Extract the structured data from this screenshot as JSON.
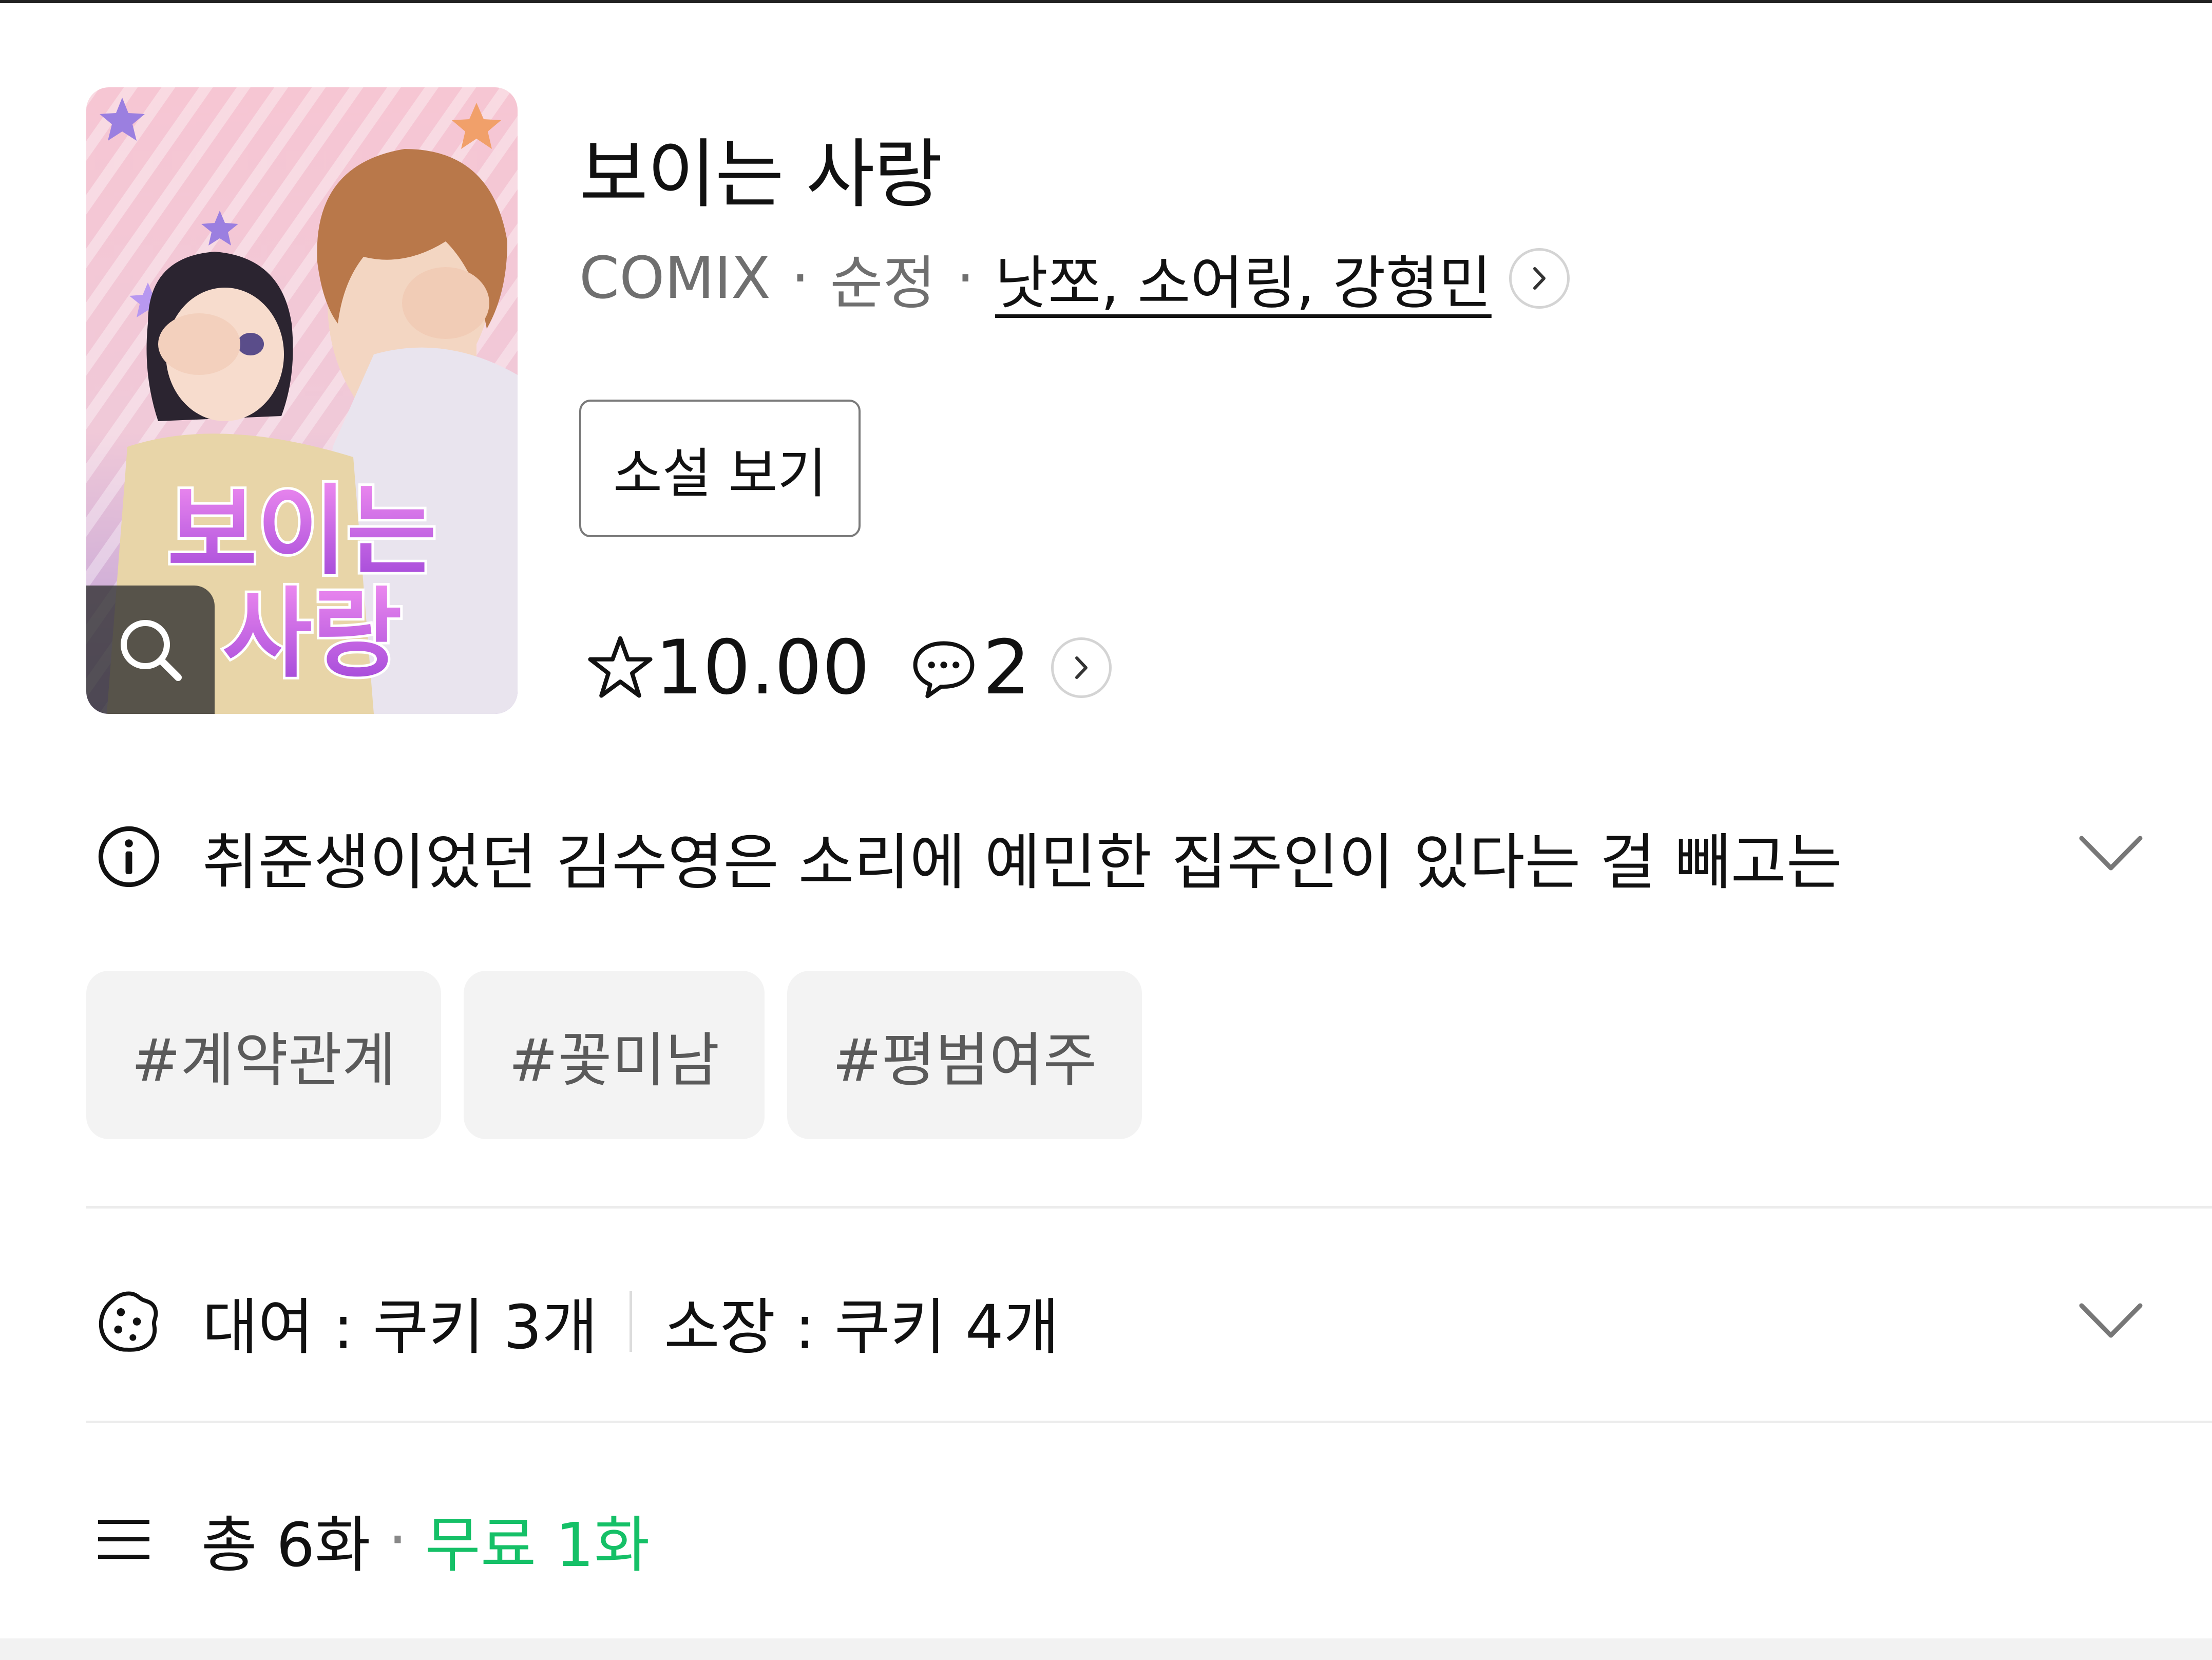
{
  "cover": {
    "alt": "보이는 사랑 표지",
    "logo_line1": "보이는",
    "logo_line2": "사랑",
    "icon": "search-icon"
  },
  "title": "보이는 사랑",
  "meta": {
    "label": "COMIX",
    "genre": "순정",
    "authors": "낫쪼, 소어링, 강형민",
    "separator": "·"
  },
  "novel_button": "소설 보기",
  "rating": "10.00",
  "comments": "2",
  "synopsis": "취준생이었던 김수영은 소리에 예민한 집주인이 있다는 걸 빼고는",
  "tags": [
    "#계약관계",
    "#꽃미남",
    "#평범여주"
  ],
  "price": {
    "rent": "대여 : 쿠키 3개",
    "own": "소장 : 쿠키 4개"
  },
  "episodes": {
    "total": "총 6화",
    "separator": "·",
    "free": "무료 1화"
  },
  "colors": {
    "accent_green": "#15c067",
    "tag_bg": "#f3f3f3",
    "divider": "#ececec"
  }
}
